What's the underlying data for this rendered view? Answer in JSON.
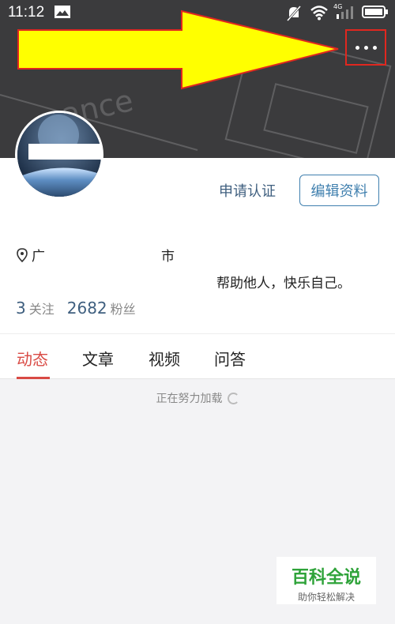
{
  "status_bar": {
    "time": "11:12",
    "network": "4G"
  },
  "header": {
    "more_icon": "more-horizontal-icon",
    "highlight_color": "#e0271f",
    "arrow_color": "#ffff00"
  },
  "profile": {
    "apply_verify_label": "申请认证",
    "edit_profile_label": "编辑资料",
    "location_prefix": "广",
    "location_city": "市",
    "bio": "帮助他人，快乐自己。",
    "following_count": "3",
    "following_label": "关注",
    "followers_count": "2682",
    "followers_label": "粉丝"
  },
  "tabs": [
    {
      "label": "动态",
      "active": true
    },
    {
      "label": "文章",
      "active": false
    },
    {
      "label": "视频",
      "active": false
    },
    {
      "label": "问答",
      "active": false
    }
  ],
  "feed": {
    "loading_text": "正在努力加载"
  },
  "watermark": {
    "title": "百科全说",
    "subtitle": "助你轻松解决"
  },
  "colors": {
    "accent": "#d94a44",
    "link": "#3f7fae"
  }
}
